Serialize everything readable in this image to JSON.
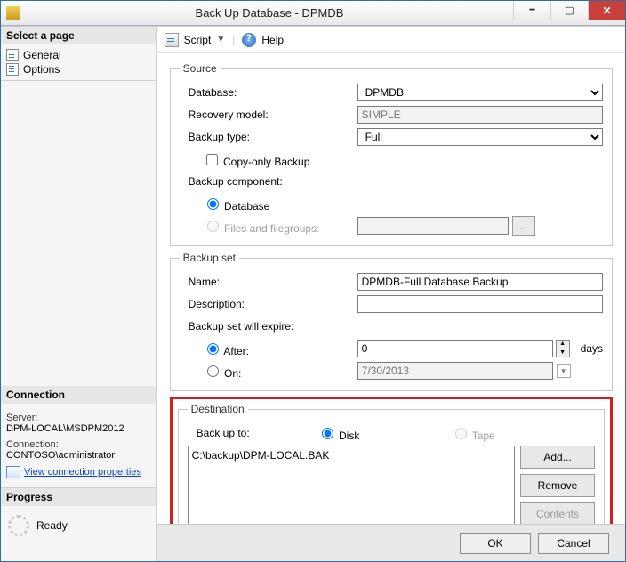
{
  "window": {
    "title": "Back Up Database - DPMDB"
  },
  "left": {
    "select_page_header": "Select a page",
    "pages": [
      "General",
      "Options"
    ],
    "connection_header": "Connection",
    "server_label": "Server:",
    "server_value": "DPM-LOCAL\\MSDPM2012",
    "conn_label": "Connection:",
    "conn_value": "CONTOSO\\administrator",
    "view_props": "View connection properties",
    "progress_header": "Progress",
    "progress_value": "Ready"
  },
  "toolbar": {
    "script": "Script",
    "help": "Help"
  },
  "source": {
    "legend": "Source",
    "database_label": "Database:",
    "database_value": "DPMDB",
    "recovery_label": "Recovery model:",
    "recovery_value": "SIMPLE",
    "type_label": "Backup type:",
    "type_value": "Full",
    "copy_only": "Copy-only Backup",
    "component_label": "Backup component:",
    "comp_database": "Database",
    "comp_files": "Files and filegroups:"
  },
  "backup_set": {
    "legend": "Backup set",
    "name_label": "Name:",
    "name_value": "DPMDB-Full Database Backup",
    "desc_label": "Description:",
    "desc_value": "",
    "expire_label": "Backup set will expire:",
    "after_label": "After:",
    "after_value": "0",
    "after_unit": "days",
    "on_label": "On:",
    "on_value": "7/30/2013"
  },
  "destination": {
    "legend": "Destination",
    "backup_to": "Back up to:",
    "disk": "Disk",
    "tape": "Tape",
    "path": "C:\\backup\\DPM-LOCAL.BAK",
    "add": "Add...",
    "remove": "Remove",
    "contents": "Contents"
  },
  "buttons": {
    "ok": "OK",
    "cancel": "Cancel"
  }
}
